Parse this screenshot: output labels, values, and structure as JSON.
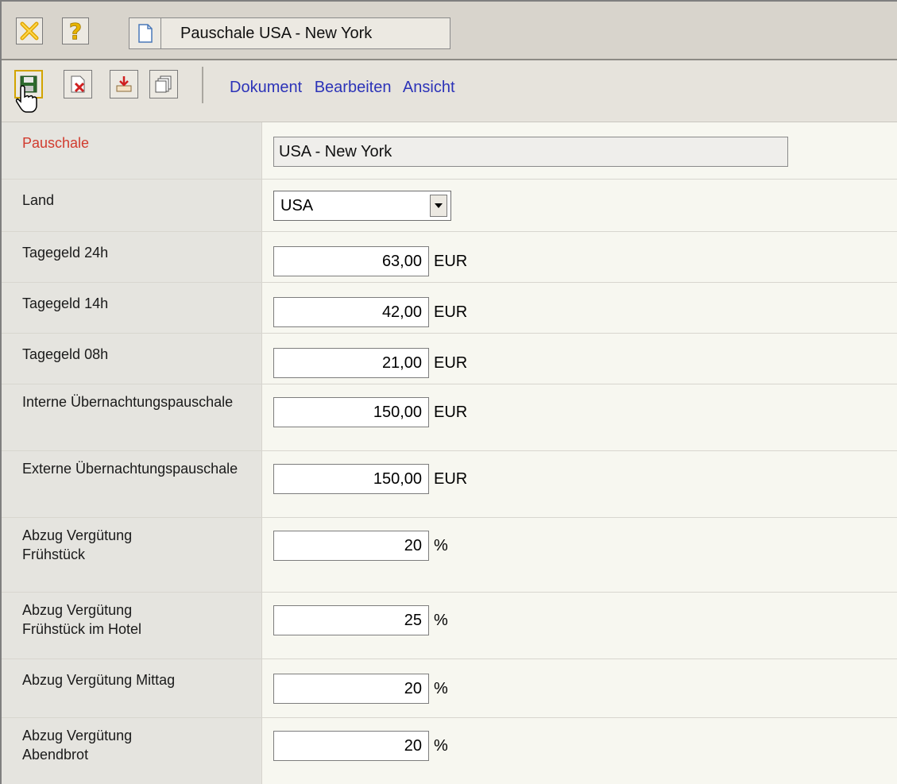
{
  "window": {
    "doc_tab_title": "Pauschale USA - New York"
  },
  "toolbar": {
    "menu": [
      "Dokument",
      "Bearbeiten",
      "Ansicht"
    ]
  },
  "form": {
    "pauschale": {
      "label": "Pauschale",
      "value": "USA - New York"
    },
    "land": {
      "label": "Land",
      "value": "USA"
    },
    "rows": [
      {
        "label": "Tagegeld 24h",
        "value": "63,00",
        "unit": "EUR"
      },
      {
        "label": "Tagegeld 14h",
        "value": "42,00",
        "unit": "EUR"
      },
      {
        "label": "Tagegeld 08h",
        "value": "21,00",
        "unit": "EUR"
      },
      {
        "label": "Interne Übernachtungspauschale",
        "value": "150,00",
        "unit": "EUR"
      },
      {
        "label": "Externe Übernachtungspauschale",
        "value": "150,00",
        "unit": "EUR"
      },
      {
        "label": "Abzug Vergütung Frühstück",
        "value": "20",
        "unit": "%"
      },
      {
        "label": "Abzug Vergütung Frühstück im Hotel",
        "value": "25",
        "unit": "%"
      },
      {
        "label": "Abzug Vergütung Mittag",
        "value": "20",
        "unit": "%"
      },
      {
        "label": "Abzug Vergütung Abendbrot",
        "value": "20",
        "unit": "%"
      }
    ]
  },
  "colors": {
    "required_label": "#d13b2e",
    "menu_link": "#2c33b8"
  }
}
